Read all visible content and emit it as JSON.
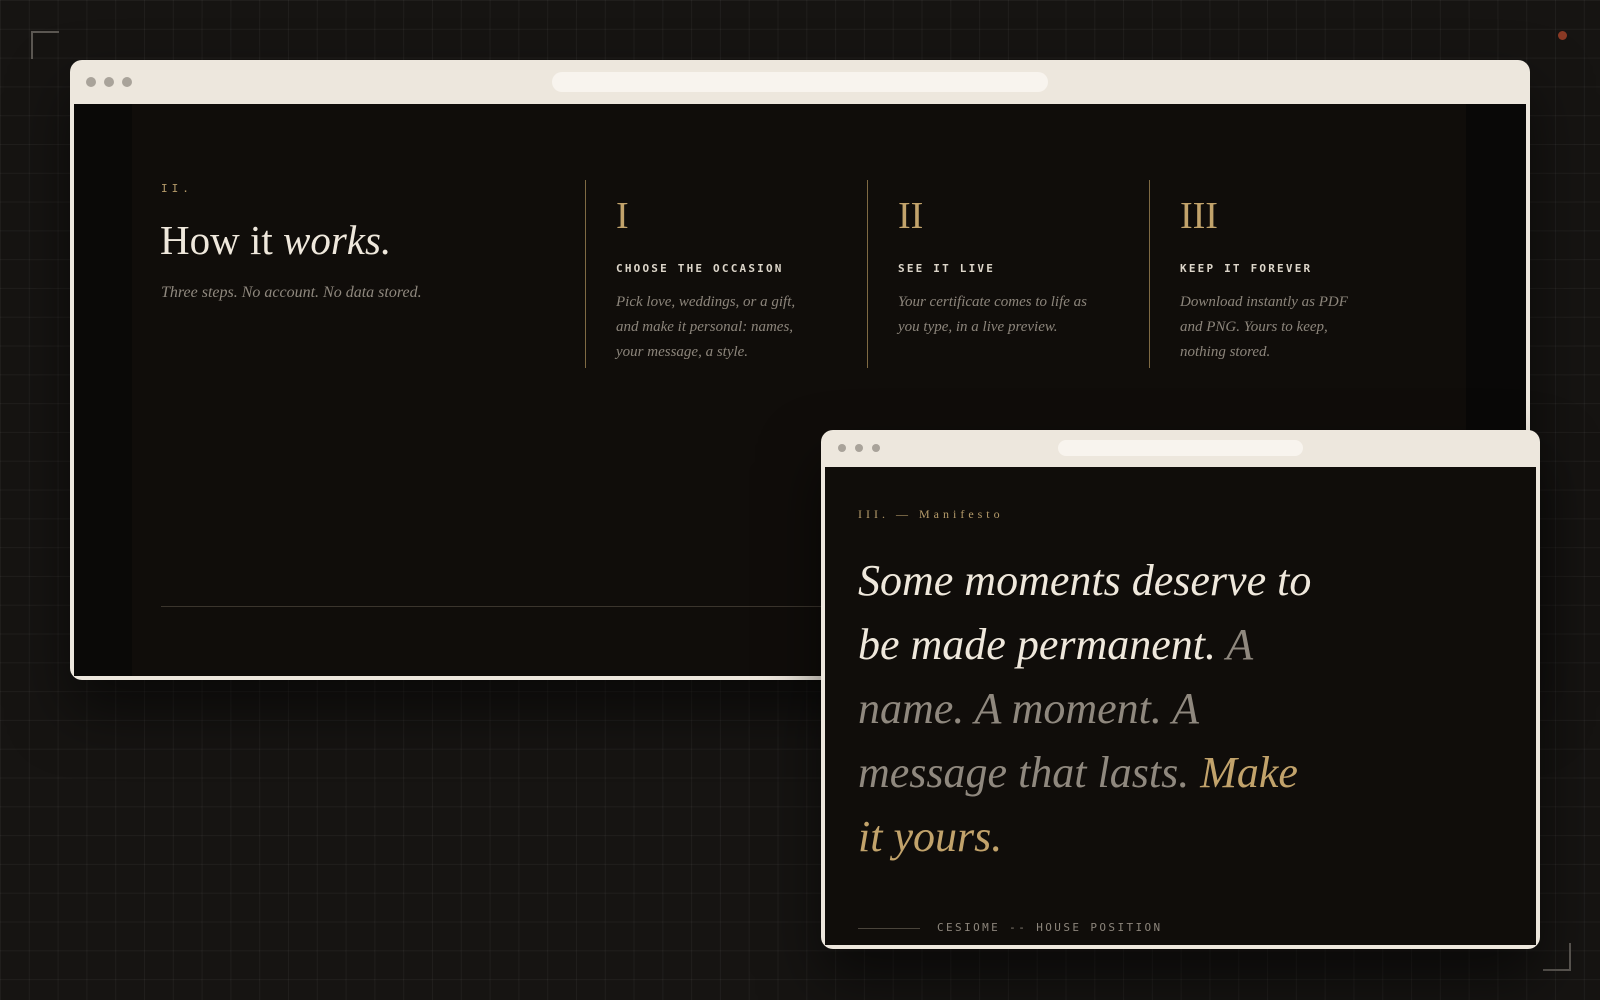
{
  "main_window": {
    "section_number": "II.",
    "title_plain": "How it",
    "title_italic": "works.",
    "subtitle": "Three steps. No account. No data stored.",
    "steps": [
      {
        "numeral": "I",
        "title": "CHOOSE THE OCCASION",
        "description": "Pick love, weddings, or a gift, and make it personal: names, your message, a style."
      },
      {
        "numeral": "II",
        "title": "SEE IT LIVE",
        "description": "Your certificate comes to life as you type, in a live preview."
      },
      {
        "numeral": "III",
        "title": "KEEP IT FOREVER",
        "description": "Download instantly as PDF and PNG. Yours to keep, nothing stored."
      }
    ]
  },
  "manifesto_window": {
    "label": "III. — Manifesto",
    "line_primary": "Some moments deserve to be made permanent.",
    "line_muted": "A name. A moment. A message that lasts.",
    "line_accent": "Make it yours.",
    "footer": "CESIOME -- HOUSE POSITION"
  },
  "colors": {
    "background": "#161412",
    "window_frame": "#ede7dd",
    "panel": "#100d0a",
    "accent_gold": "#c2a36b",
    "text_light": "#efe8dc",
    "text_muted": "#8f887e",
    "status_dot": "#8a3a25"
  }
}
